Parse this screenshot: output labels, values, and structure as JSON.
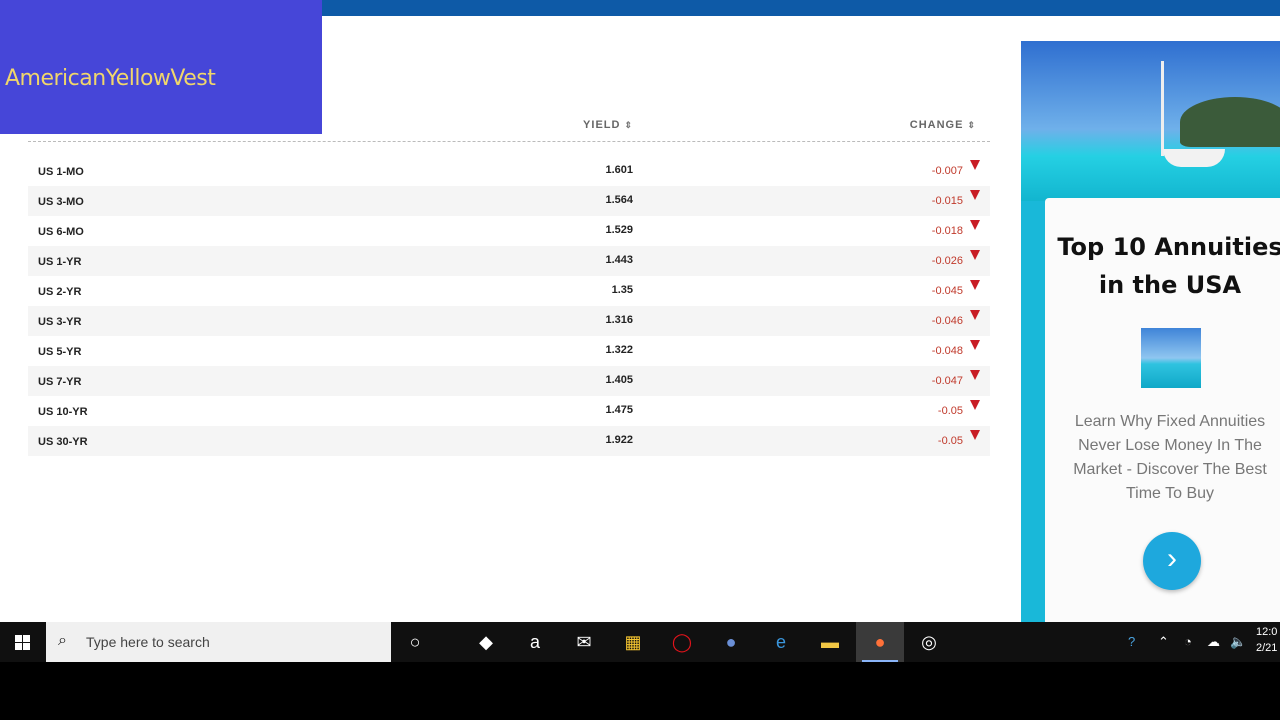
{
  "brand": {
    "name": "AmericanYellowVest"
  },
  "table": {
    "headers": {
      "yield": "YIELD",
      "change": "CHANGE"
    },
    "rows": [
      {
        "name": "US 1-MO",
        "yield": "1.601",
        "change": "-0.007"
      },
      {
        "name": "US 3-MO",
        "yield": "1.564",
        "change": "-0.015"
      },
      {
        "name": "US 6-MO",
        "yield": "1.529",
        "change": "-0.018"
      },
      {
        "name": "US 1-YR",
        "yield": "1.443",
        "change": "-0.026"
      },
      {
        "name": "US 2-YR",
        "yield": "1.35",
        "change": "-0.045"
      },
      {
        "name": "US 3-YR",
        "yield": "1.316",
        "change": "-0.046"
      },
      {
        "name": "US 5-YR",
        "yield": "1.322",
        "change": "-0.048"
      },
      {
        "name": "US 7-YR",
        "yield": "1.405",
        "change": "-0.047"
      },
      {
        "name": "US 10-YR",
        "yield": "1.475",
        "change": "-0.05"
      },
      {
        "name": "US 30-YR",
        "yield": "1.922",
        "change": "-0.05"
      }
    ],
    "down_color": "#c81d25"
  },
  "ad": {
    "title_line1": "Top 10 Annuities",
    "title_line2": "in the USA",
    "text_lines": [
      "Learn Why Fixed Annuities",
      "Never Lose Money In The",
      "Market - Discover The Best",
      "Time To Buy"
    ]
  },
  "taskbar": {
    "search_placeholder": "Type here to search",
    "apps": [
      "cortana-icon",
      "dropbox-icon",
      "amazon-icon",
      "mail-icon",
      "store-icon",
      "opera-icon",
      "app-icon",
      "edge-icon",
      "file-explorer-icon",
      "firefox-icon",
      "obs-icon"
    ],
    "clock_line1": "12:0",
    "clock_line2": "2/21"
  }
}
